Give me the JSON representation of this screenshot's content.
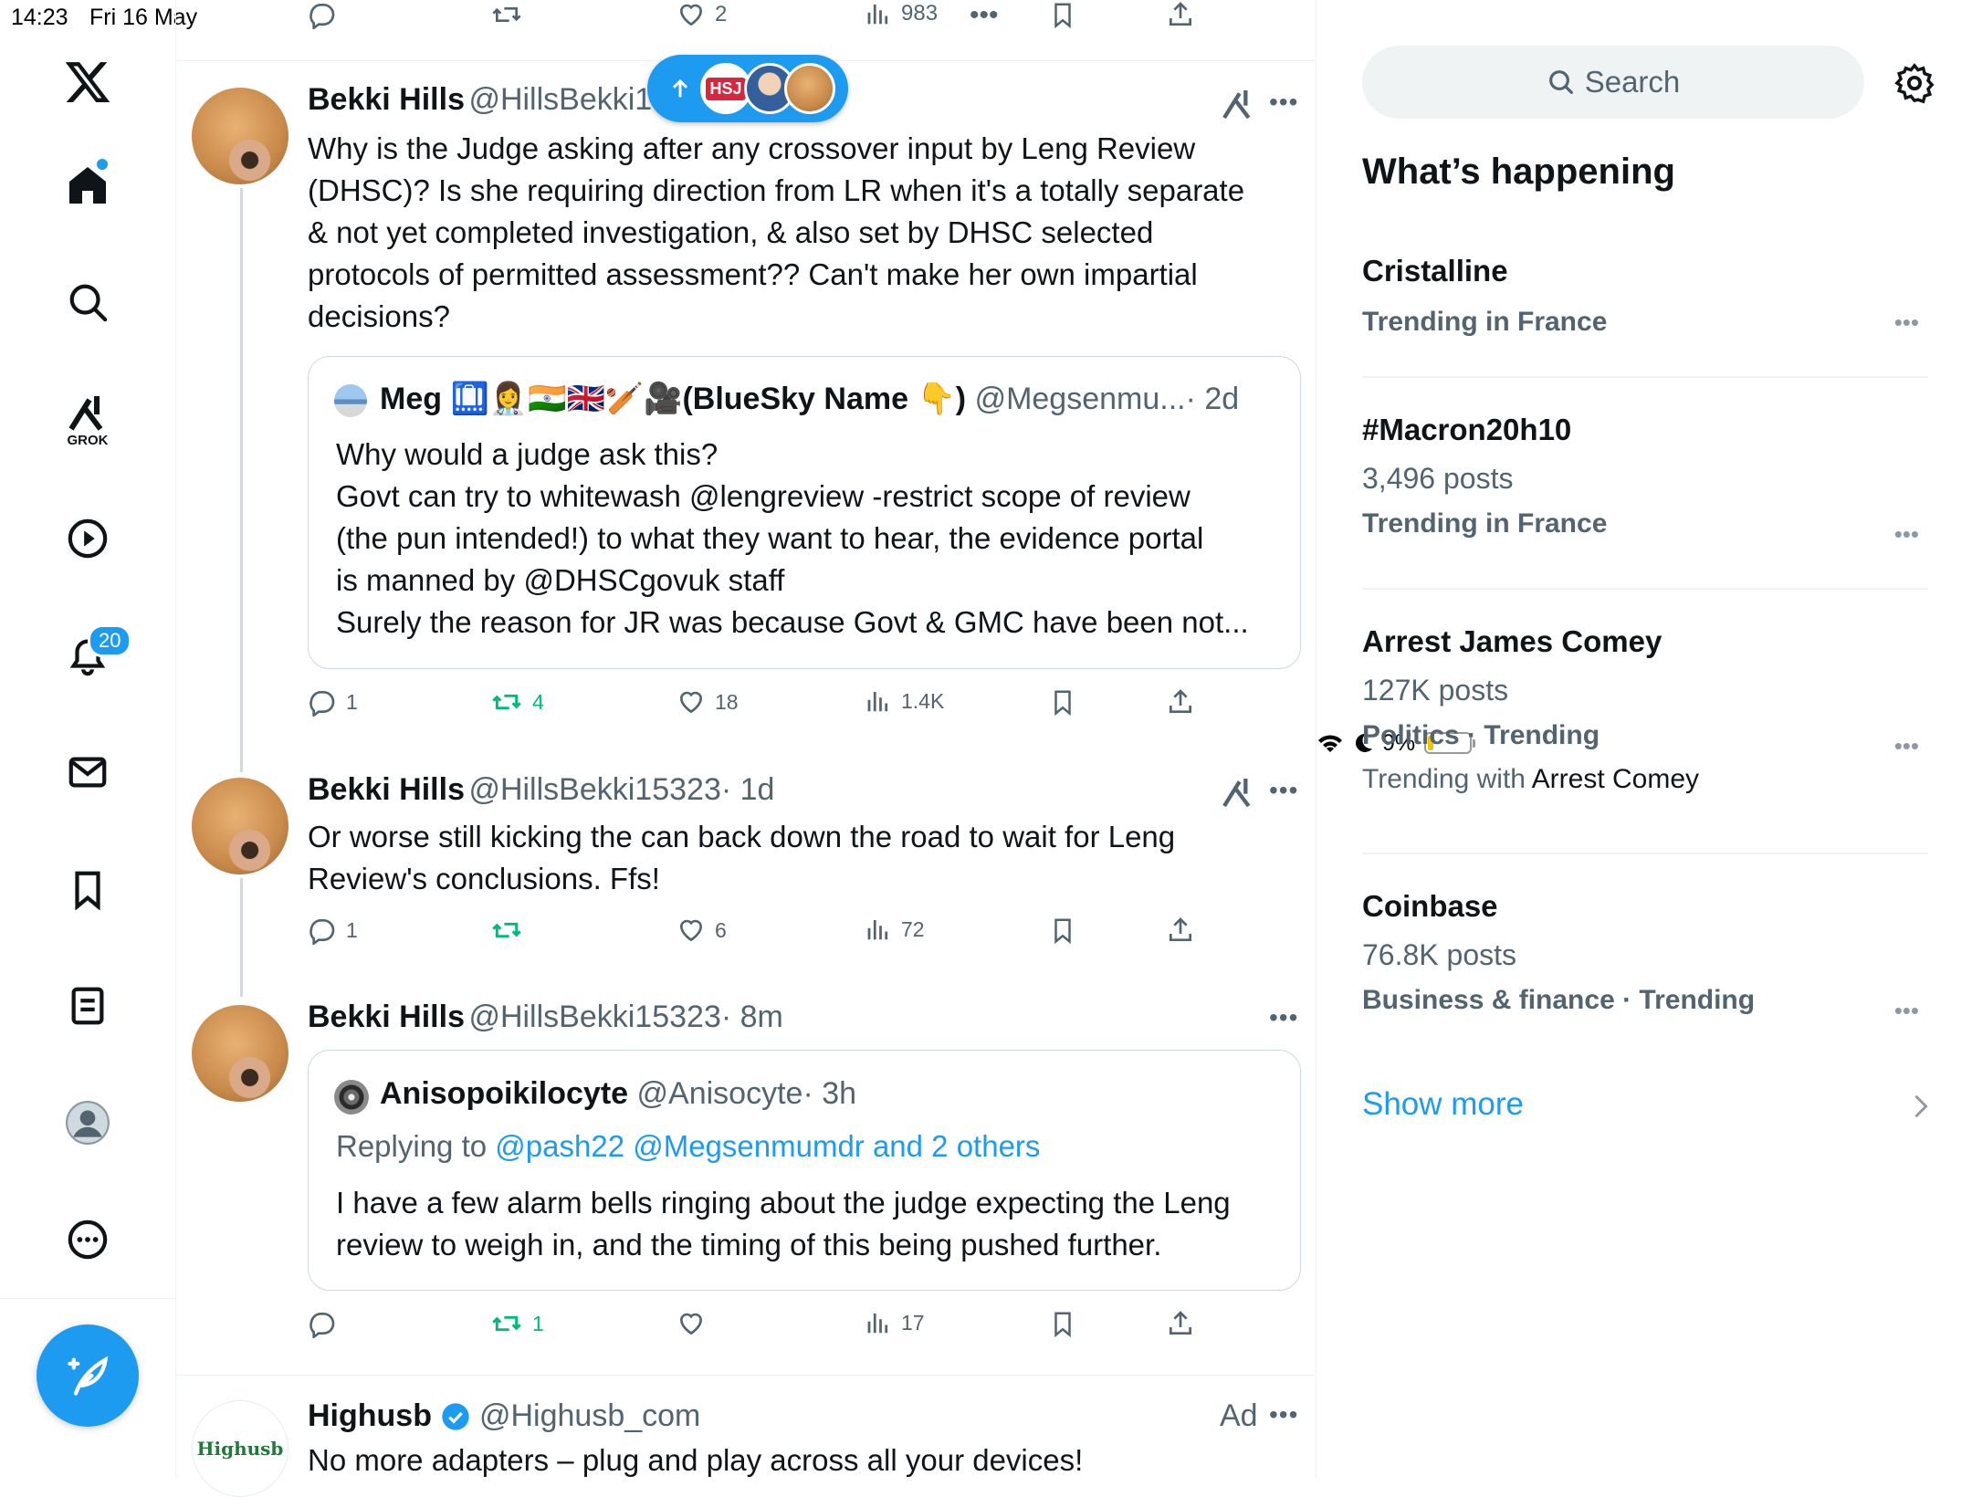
{
  "status_bar": {
    "time": "14:23",
    "date": "Fri 16 May",
    "battery": "9%"
  },
  "nav": {
    "notifications_count": "20",
    "grok_label": "GROK"
  },
  "top_actions": {
    "reply": "",
    "repost": "",
    "likes": "2",
    "views": "983"
  },
  "tweets": [
    {
      "name": "Bekki Hills",
      "handle": "@HillsBekki1",
      "text_lines": [
        "Why is the Judge asking after any crossover input by Leng Review",
        "(DHSC)? Is she requiring  direction from LR when it's a totally separate",
        "& not yet completed investigation, & also set by DHSC selected",
        "protocols of permitted assessment?? Can't make her own impartial",
        "decisions?"
      ],
      "quote": {
        "name": "Meg",
        "name_suffix": "🛄👩‍⚕️🇮🇳🇬🇧🏏🎥(BlueSky Name 👇)",
        "handle": "@Megsenmu...",
        "time": "· 2d",
        "lines": [
          "Why would a judge ask this?",
          "Govt can try to whitewash @lengreview -restrict scope of review",
          "(the pun intended!) to what they want to hear, the evidence portal",
          "is manned by @DHSCgovuk staff",
          "Surely the reason for JR was because Govt & GMC have been not..."
        ]
      },
      "replies": "1",
      "reposts": "4",
      "likes": "18",
      "views": "1.4K"
    },
    {
      "name": "Bekki Hills",
      "handle": "@HillsBekki15323",
      "time": "· 1d",
      "text_lines": [
        "Or worse still kicking the can back down the road to wait for Leng",
        "Review's conclusions. Ffs!"
      ],
      "replies": "1",
      "reposts": "",
      "likes": "6",
      "views": "72"
    },
    {
      "name": "Bekki Hills",
      "handle": "@HillsBekki15323",
      "time": "· 8m",
      "quote": {
        "name": "Anisopoikilocyte",
        "handle": "@Anisocyte",
        "time": "· 3h",
        "replying_prefix": "Replying to",
        "replying_to": "@pash22 @Megsenmumdr and 2 others",
        "lines": [
          "I have a few alarm bells ringing about the judge expecting the Leng",
          "review to weigh in, and the timing of this being pushed further."
        ]
      },
      "replies": "",
      "reposts": "1",
      "likes": "",
      "views": "17"
    },
    {
      "name": "Highusb",
      "handle": "@Highusb_com",
      "ad_label": "Ad",
      "avatar_text": "Highusb",
      "text": "No more adapters – plug and play across all your devices!"
    }
  ],
  "pill": {
    "label": "HSJ"
  },
  "sidebar": {
    "search_placeholder": "Search",
    "title": "What’s happening",
    "trends": [
      {
        "name": "Cristalline",
        "context": "Trending in France"
      },
      {
        "name": "#Macron20h10",
        "posts": "3,496 posts",
        "context": "Trending in France"
      },
      {
        "name": "Arrest James Comey",
        "posts": "127K posts",
        "context": "Politics · Trending",
        "with_prefix": "Trending with",
        "with_term": "Arrest Comey"
      },
      {
        "name": "Coinbase",
        "posts": "76.8K posts",
        "context": "Business & finance · Trending"
      }
    ],
    "show_more": "Show more"
  },
  "colors": {
    "accent": "#1d9bf0",
    "repost_green": "#00ba7c",
    "muted": "#536471"
  }
}
